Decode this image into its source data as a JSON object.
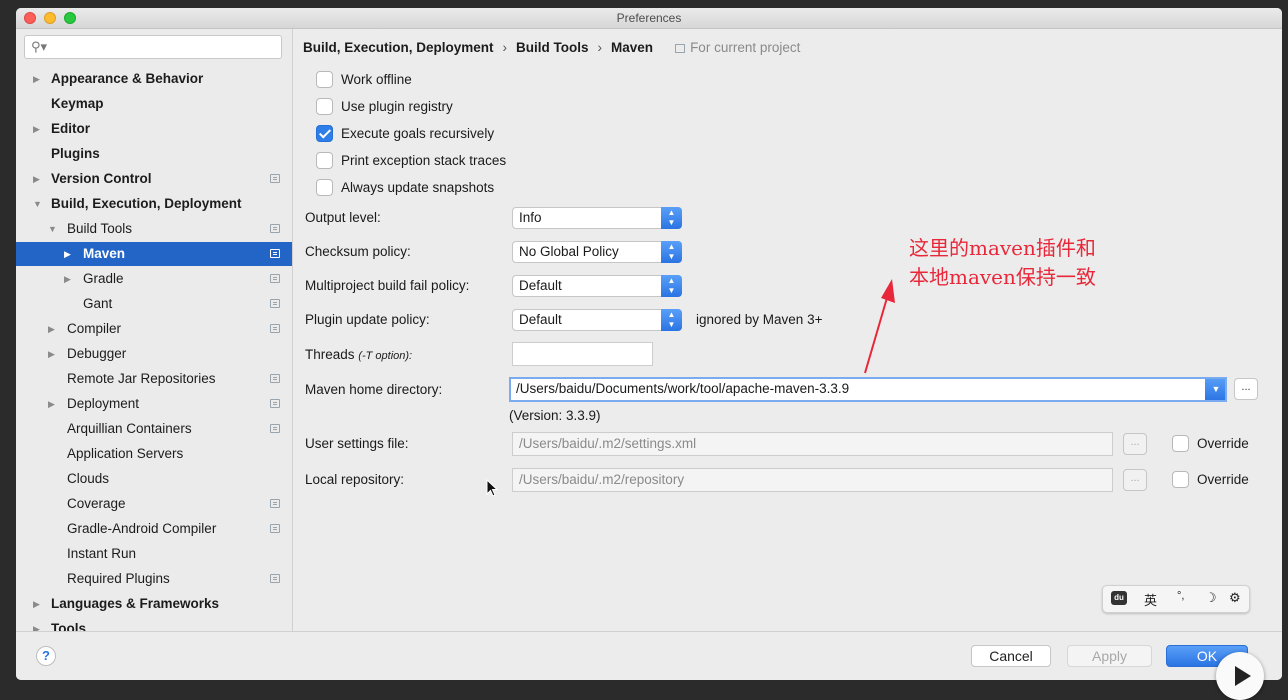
{
  "window": {
    "title": "Preferences"
  },
  "sidebar": {
    "search_placeholder": "",
    "items": [
      {
        "label": "Appearance & Behavior",
        "arrow": "▶",
        "bold": true,
        "level": 0,
        "icon": false
      },
      {
        "label": "Keymap",
        "arrow": "",
        "bold": true,
        "level": 0,
        "icon": false
      },
      {
        "label": "Editor",
        "arrow": "▶",
        "bold": true,
        "level": 0,
        "icon": false
      },
      {
        "label": "Plugins",
        "arrow": "",
        "bold": true,
        "level": 0,
        "icon": false
      },
      {
        "label": "Version Control",
        "arrow": "▶",
        "bold": true,
        "level": 0,
        "icon": true
      },
      {
        "label": "Build, Execution, Deployment",
        "arrow": "▼",
        "bold": true,
        "level": 0,
        "icon": false
      },
      {
        "label": "Build Tools",
        "arrow": "▼",
        "bold": false,
        "level": 1,
        "icon": true
      },
      {
        "label": "Maven",
        "arrow": "▶",
        "bold": true,
        "level": 2,
        "icon": true,
        "selected": true
      },
      {
        "label": "Gradle",
        "arrow": "▶",
        "bold": false,
        "level": 2,
        "icon": true
      },
      {
        "label": "Gant",
        "arrow": "",
        "bold": false,
        "level": 2,
        "icon": true
      },
      {
        "label": "Compiler",
        "arrow": "▶",
        "bold": false,
        "level": 1,
        "icon": true
      },
      {
        "label": "Debugger",
        "arrow": "▶",
        "bold": false,
        "level": 1,
        "icon": false
      },
      {
        "label": "Remote Jar Repositories",
        "arrow": "",
        "bold": false,
        "level": 1,
        "icon": true
      },
      {
        "label": "Deployment",
        "arrow": "▶",
        "bold": false,
        "level": 1,
        "icon": true
      },
      {
        "label": "Arquillian Containers",
        "arrow": "",
        "bold": false,
        "level": 1,
        "icon": true
      },
      {
        "label": "Application Servers",
        "arrow": "",
        "bold": false,
        "level": 1,
        "icon": false
      },
      {
        "label": "Clouds",
        "arrow": "",
        "bold": false,
        "level": 1,
        "icon": false
      },
      {
        "label": "Coverage",
        "arrow": "",
        "bold": false,
        "level": 1,
        "icon": true
      },
      {
        "label": "Gradle-Android Compiler",
        "arrow": "",
        "bold": false,
        "level": 1,
        "icon": true
      },
      {
        "label": "Instant Run",
        "arrow": "",
        "bold": false,
        "level": 1,
        "icon": false
      },
      {
        "label": "Required Plugins",
        "arrow": "",
        "bold": false,
        "level": 1,
        "icon": true
      },
      {
        "label": "Languages & Frameworks",
        "arrow": "▶",
        "bold": true,
        "level": 0,
        "icon": false
      },
      {
        "label": "Tools",
        "arrow": "▶",
        "bold": true,
        "level": 0,
        "icon": false
      }
    ]
  },
  "breadcrumb": {
    "parts": [
      "Build, Execution, Deployment",
      "Build Tools",
      "Maven"
    ],
    "separator": "›",
    "scope": "For current project"
  },
  "options": {
    "work_offline": {
      "label": "Work offline",
      "checked": false
    },
    "use_plugin_registry": {
      "label": "Use plugin registry",
      "checked": false
    },
    "execute_goals": {
      "label": "Execute goals recursively",
      "checked": true
    },
    "print_exception": {
      "label": "Print exception stack traces",
      "checked": false
    },
    "always_update": {
      "label": "Always update snapshots",
      "checked": false
    }
  },
  "fields": {
    "output_level": {
      "label": "Output level:",
      "value": "Info"
    },
    "checksum_policy": {
      "label": "Checksum policy:",
      "value": "No Global Policy"
    },
    "multiproject_policy": {
      "label": "Multiproject build fail policy:",
      "value": "Default"
    },
    "plugin_update_policy": {
      "label": "Plugin update policy:",
      "value": "Default",
      "note": "ignored by Maven 3+"
    },
    "threads": {
      "label": "Threads",
      "hint": "(-T option):",
      "value": ""
    },
    "maven_home": {
      "label": "Maven home directory:",
      "value": "/Users/baidu/Documents/work/tool/apache-maven-3.3.9",
      "version": "(Version: 3.3.9)"
    },
    "user_settings": {
      "label": "User settings file:",
      "value": "/Users/baidu/.m2/settings.xml",
      "override_label": "Override"
    },
    "local_repository": {
      "label": "Local repository:",
      "value": "/Users/baidu/.m2/repository",
      "override_label": "Override"
    }
  },
  "annotation": {
    "line1": "这里的maven插件和",
    "line2": "本地maven保持一致",
    "color": "#e8283a"
  },
  "ime": {
    "badge": "du",
    "lang": "英",
    "punct": "°,",
    "moon": "☽",
    "gear": "⚙"
  },
  "buttons": {
    "help": "?",
    "cancel": "Cancel",
    "apply": "Apply",
    "ok": "OK",
    "dots": "..."
  },
  "colors": {
    "accent": "#2a74e3",
    "selection": "#2265c7"
  }
}
